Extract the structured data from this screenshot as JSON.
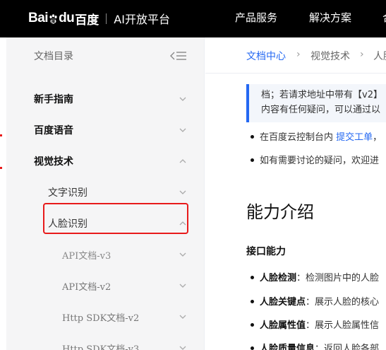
{
  "header": {
    "logo_latin": "Bai",
    "logo_latin2": "du",
    "logo_cn": "百度",
    "platform": "AI开放平台",
    "nav": [
      "产品服务",
      "解决方案",
      "合"
    ]
  },
  "sidebar": {
    "title": "文档目录",
    "items": [
      {
        "label": "新手指南",
        "level": 1,
        "expanded": false
      },
      {
        "label": "百度语音",
        "level": 1,
        "expanded": false
      },
      {
        "label": "视觉技术",
        "level": 1,
        "expanded": true
      },
      {
        "label": "文字识别",
        "level": 2,
        "expanded": false
      },
      {
        "label": "人脸识别",
        "level": 2,
        "expanded": true
      },
      {
        "label": "API文档-v3",
        "level": 3,
        "expanded": false,
        "selected": true
      },
      {
        "label": "API文档-v2",
        "level": 3,
        "expanded": false
      },
      {
        "label": "Http SDK文档-v2",
        "level": 3,
        "expanded": false
      },
      {
        "label": "Http SDK文档-v3",
        "level": 3,
        "expanded": false
      }
    ]
  },
  "breadcrumb": {
    "items": [
      "文档中心",
      "视觉技术",
      "人脸"
    ]
  },
  "content": {
    "note_line1": "档；若请求地址中带有【v2】",
    "note_line2": "内容有任何疑问，可以通过以",
    "bullet1_text": "在百度云控制台内 ",
    "bullet1_link": "提交工单",
    "bullet1_tail": "，",
    "bullet2_text": "如有需要讨论的疑问，欢迎进",
    "heading": "能力介绍",
    "subheading": "接口能力",
    "features": [
      {
        "name": "人脸检测",
        "desc": "：检测图片中的人脸"
      },
      {
        "name": "人脸关键点",
        "desc": "：展示人脸的核心"
      },
      {
        "name": "人脸属性值",
        "desc": "：展示人脸属性信"
      },
      {
        "name": "人脸质量信息",
        "desc": "：返回人脸各部"
      }
    ]
  },
  "colors": {
    "link": "#2468f2",
    "highlight_border": "#e81b1b",
    "topbar": "#000000",
    "sidebar_bg": "#f5f5f6"
  }
}
